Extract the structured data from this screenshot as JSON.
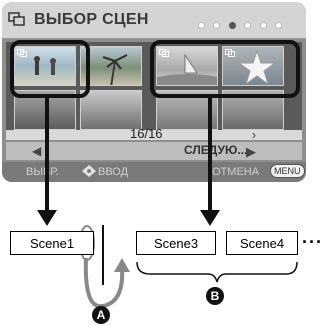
{
  "screen": {
    "title": "ВЫБОР СЦЕН",
    "page_counter": "16/16",
    "next_label": "СЛЕДУЮ...",
    "bottom_select": "ВЫБР.",
    "bottom_enter": "ВВОД",
    "bottom_cancel": "ОТМЕНА",
    "menu_badge": "MENU"
  },
  "diagram": {
    "scene1": "Scene1",
    "scene3": "Scene3",
    "scene4": "Scene4",
    "ellipsis": "···",
    "label_a": "A",
    "label_b": "B"
  }
}
